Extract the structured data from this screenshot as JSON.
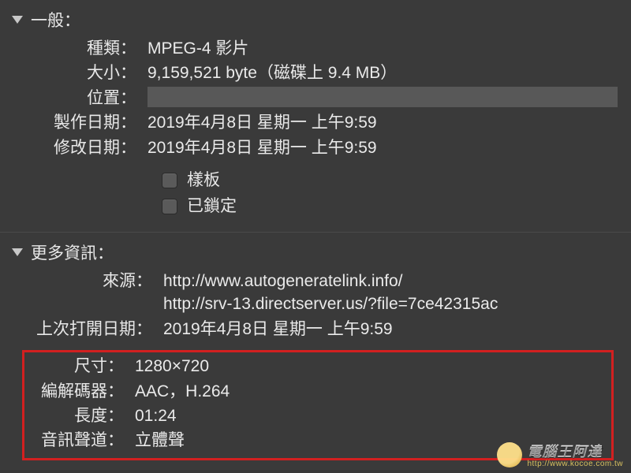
{
  "sections": {
    "general": {
      "title": "一般：",
      "kind_label": "種類：",
      "kind_value": "MPEG-4 影片",
      "size_label": "大小：",
      "size_value": "9,159,521 byte（磁碟上 9.4 MB）",
      "location_label": "位置：",
      "created_label": "製作日期：",
      "created_value": "2019年4月8日 星期一 上午9:59",
      "modified_label": "修改日期：",
      "modified_value": "2019年4月8日 星期一 上午9:59",
      "stationery_label": "樣板",
      "locked_label": "已鎖定"
    },
    "more": {
      "title": "更多資訊：",
      "source_label": "來源：",
      "source_value_1": "http://www.autogeneratelink.info/",
      "source_value_2": "http://srv-13.directserver.us/?file=7ce42315ac",
      "last_opened_label": "上次打開日期：",
      "last_opened_value": "2019年4月8日 星期一 上午9:59",
      "dimensions_label": "尺寸：",
      "dimensions_value": "1280×720",
      "codecs_label": "編解碼器：",
      "codecs_value": "AAC，H.264",
      "duration_label": "長度：",
      "duration_value": "01:24",
      "audio_label": "音訊聲道：",
      "audio_value": "立體聲"
    }
  },
  "watermark": {
    "title": "電腦王阿達",
    "sub": "http://www.kocoe.com.tw"
  }
}
